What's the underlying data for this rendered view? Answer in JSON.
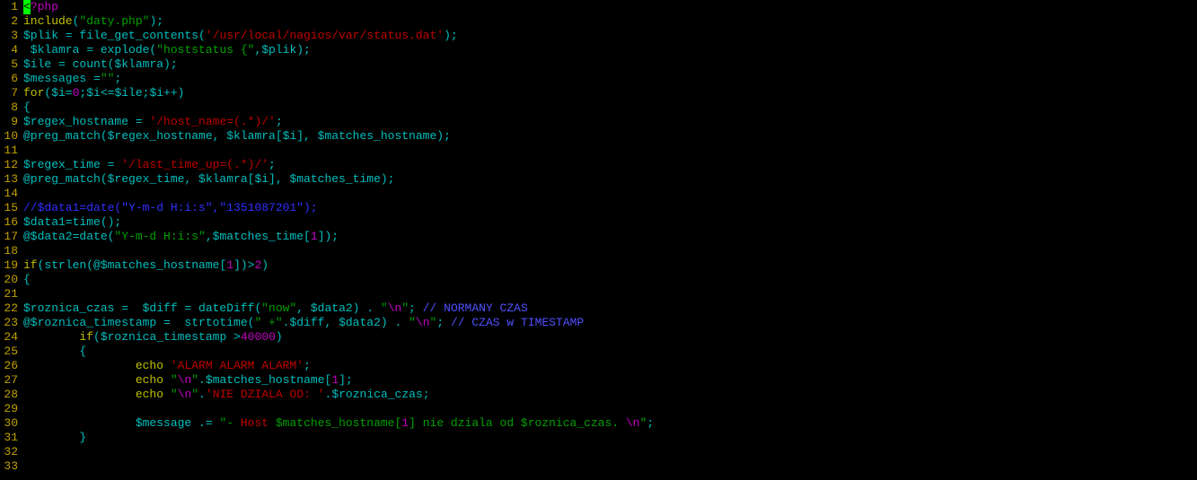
{
  "total_lines": 33,
  "cursor_line": 1,
  "lines": [
    {
      "n": 1,
      "spans": [
        {
          "t": "<",
          "cls": "cursor"
        },
        {
          "t": "?php",
          "cls": "c-magenta"
        }
      ]
    },
    {
      "n": 2,
      "spans": [
        {
          "t": "include",
          "cls": "c-keyword"
        },
        {
          "t": "(",
          "cls": "c-default"
        },
        {
          "t": "\"daty.php\"",
          "cls": "c-green"
        },
        {
          "t": ");",
          "cls": "c-default"
        }
      ]
    },
    {
      "n": 3,
      "spans": [
        {
          "t": "$plik = file_get_contents(",
          "cls": "c-default"
        },
        {
          "t": "'/usr/local/nagios/var/status.dat'",
          "cls": "c-red"
        },
        {
          "t": ");",
          "cls": "c-default"
        }
      ]
    },
    {
      "n": 4,
      "spans": [
        {
          "t": " $klamra = explode(",
          "cls": "c-default"
        },
        {
          "t": "\"hoststatus {\"",
          "cls": "c-green"
        },
        {
          "t": ",$plik);",
          "cls": "c-default"
        }
      ]
    },
    {
      "n": 5,
      "spans": [
        {
          "t": "$ile = count($klamra);",
          "cls": "c-default"
        }
      ]
    },
    {
      "n": 6,
      "spans": [
        {
          "t": "$messages =",
          "cls": "c-default"
        },
        {
          "t": "\"\"",
          "cls": "c-green"
        },
        {
          "t": ";",
          "cls": "c-default"
        }
      ]
    },
    {
      "n": 7,
      "spans": [
        {
          "t": "for",
          "cls": "c-keyword"
        },
        {
          "t": "($i=",
          "cls": "c-default"
        },
        {
          "t": "0",
          "cls": "c-magenta"
        },
        {
          "t": ";$i<=$ile;$i++)",
          "cls": "c-default"
        }
      ]
    },
    {
      "n": 8,
      "spans": [
        {
          "t": "{",
          "cls": "c-default"
        }
      ]
    },
    {
      "n": 9,
      "spans": [
        {
          "t": "$regex_hostname = ",
          "cls": "c-default"
        },
        {
          "t": "'/host_name=(.*)/'",
          "cls": "c-red"
        },
        {
          "t": ";",
          "cls": "c-default"
        }
      ]
    },
    {
      "n": 10,
      "spans": [
        {
          "t": "@preg_match($regex_hostname, $klamra[$i], $matches_hostname);",
          "cls": "c-default"
        }
      ]
    },
    {
      "n": 11,
      "spans": []
    },
    {
      "n": 12,
      "spans": [
        {
          "t": "$regex_time = ",
          "cls": "c-default"
        },
        {
          "t": "'/last_time_up=(.*)/'",
          "cls": "c-red"
        },
        {
          "t": ";",
          "cls": "c-default"
        }
      ]
    },
    {
      "n": 13,
      "spans": [
        {
          "t": "@preg_match($regex_time, $klamra[$i], $matches_time);",
          "cls": "c-default"
        }
      ]
    },
    {
      "n": 14,
      "spans": []
    },
    {
      "n": 15,
      "spans": [
        {
          "t": "//$data1=date(\"Y-m-d H:i:s\",\"1351087201\");",
          "cls": "c-blue"
        }
      ]
    },
    {
      "n": 16,
      "spans": [
        {
          "t": "$data1=time();",
          "cls": "c-default"
        }
      ]
    },
    {
      "n": 17,
      "spans": [
        {
          "t": "@$data2=date(",
          "cls": "c-default"
        },
        {
          "t": "\"Y-m-d H:i:s\"",
          "cls": "c-green"
        },
        {
          "t": ",$matches_time[",
          "cls": "c-default"
        },
        {
          "t": "1",
          "cls": "c-magenta"
        },
        {
          "t": "]);",
          "cls": "c-default"
        }
      ]
    },
    {
      "n": 18,
      "spans": []
    },
    {
      "n": 19,
      "spans": [
        {
          "t": "if",
          "cls": "c-keyword"
        },
        {
          "t": "(strlen(@$matches_hostname[",
          "cls": "c-default"
        },
        {
          "t": "1",
          "cls": "c-magenta"
        },
        {
          "t": "])>",
          "cls": "c-default"
        },
        {
          "t": "2",
          "cls": "c-magenta"
        },
        {
          "t": ")",
          "cls": "c-default"
        }
      ]
    },
    {
      "n": 20,
      "spans": [
        {
          "t": "{",
          "cls": "c-default"
        }
      ]
    },
    {
      "n": 21,
      "spans": []
    },
    {
      "n": 22,
      "spans": [
        {
          "t": "$roznica_czas =  $diff = dateDiff(",
          "cls": "c-default"
        },
        {
          "t": "\"now\"",
          "cls": "c-green"
        },
        {
          "t": ", $data2) . ",
          "cls": "c-default"
        },
        {
          "t": "\"",
          "cls": "c-green"
        },
        {
          "t": "\\n",
          "cls": "c-magenta"
        },
        {
          "t": "\"",
          "cls": "c-green"
        },
        {
          "t": "; ",
          "cls": "c-default"
        },
        {
          "t": "// NORMANY CZAS",
          "cls": "c-blue-b"
        }
      ]
    },
    {
      "n": 23,
      "spans": [
        {
          "t": "@$roznica_timestamp =  strtotime(",
          "cls": "c-default"
        },
        {
          "t": "\" +\"",
          "cls": "c-green"
        },
        {
          "t": ".$diff, $data2) . ",
          "cls": "c-default"
        },
        {
          "t": "\"",
          "cls": "c-green"
        },
        {
          "t": "\\n",
          "cls": "c-magenta"
        },
        {
          "t": "\"",
          "cls": "c-green"
        },
        {
          "t": "; ",
          "cls": "c-default"
        },
        {
          "t": "// CZAS w TIMESTAMP",
          "cls": "c-blue-b"
        }
      ]
    },
    {
      "n": 24,
      "spans": [
        {
          "t": "        ",
          "cls": "c-default"
        },
        {
          "t": "if",
          "cls": "c-keyword"
        },
        {
          "t": "($roznica_timestamp >",
          "cls": "c-default"
        },
        {
          "t": "40000",
          "cls": "c-magenta"
        },
        {
          "t": ")",
          "cls": "c-default"
        }
      ]
    },
    {
      "n": 25,
      "spans": [
        {
          "t": "        {",
          "cls": "c-default"
        }
      ]
    },
    {
      "n": 26,
      "spans": [
        {
          "t": "                ",
          "cls": "c-default"
        },
        {
          "t": "echo",
          "cls": "c-keyword"
        },
        {
          "t": " ",
          "cls": "c-default"
        },
        {
          "t": "'ALARM ALARM ALARM'",
          "cls": "c-red"
        },
        {
          "t": ";",
          "cls": "c-default"
        }
      ]
    },
    {
      "n": 27,
      "spans": [
        {
          "t": "                ",
          "cls": "c-default"
        },
        {
          "t": "echo",
          "cls": "c-keyword"
        },
        {
          "t": " ",
          "cls": "c-default"
        },
        {
          "t": "\"",
          "cls": "c-green"
        },
        {
          "t": "\\n",
          "cls": "c-magenta"
        },
        {
          "t": "\"",
          "cls": "c-green"
        },
        {
          "t": ".$matches_hostname[",
          "cls": "c-default"
        },
        {
          "t": "1",
          "cls": "c-magenta"
        },
        {
          "t": "];",
          "cls": "c-default"
        }
      ]
    },
    {
      "n": 28,
      "spans": [
        {
          "t": "                ",
          "cls": "c-default"
        },
        {
          "t": "echo",
          "cls": "c-keyword"
        },
        {
          "t": " ",
          "cls": "c-default"
        },
        {
          "t": "\"",
          "cls": "c-green"
        },
        {
          "t": "\\n",
          "cls": "c-magenta"
        },
        {
          "t": "\"",
          "cls": "c-green"
        },
        {
          "t": ".",
          "cls": "c-default"
        },
        {
          "t": "'NIE DZIALA OD: '",
          "cls": "c-red"
        },
        {
          "t": ".$roznica_czas;",
          "cls": "c-default"
        }
      ]
    },
    {
      "n": 29,
      "spans": []
    },
    {
      "n": 30,
      "spans": [
        {
          "t": "                $message .= ",
          "cls": "c-default"
        },
        {
          "t": "\"- ",
          "cls": "c-green"
        },
        {
          "t": "Host",
          "cls": "c-red"
        },
        {
          "t": " $matches_hostname[",
          "cls": "c-green"
        },
        {
          "t": "1",
          "cls": "c-magenta"
        },
        {
          "t": "] nie dziala od $roznica_czas. ",
          "cls": "c-green"
        },
        {
          "t": "\\n",
          "cls": "c-magenta"
        },
        {
          "t": "\"",
          "cls": "c-green"
        },
        {
          "t": ";",
          "cls": "c-default"
        }
      ]
    },
    {
      "n": 31,
      "spans": [
        {
          "t": "        }",
          "cls": "c-default"
        }
      ]
    },
    {
      "n": 32,
      "spans": []
    },
    {
      "n": 33,
      "spans": []
    }
  ]
}
